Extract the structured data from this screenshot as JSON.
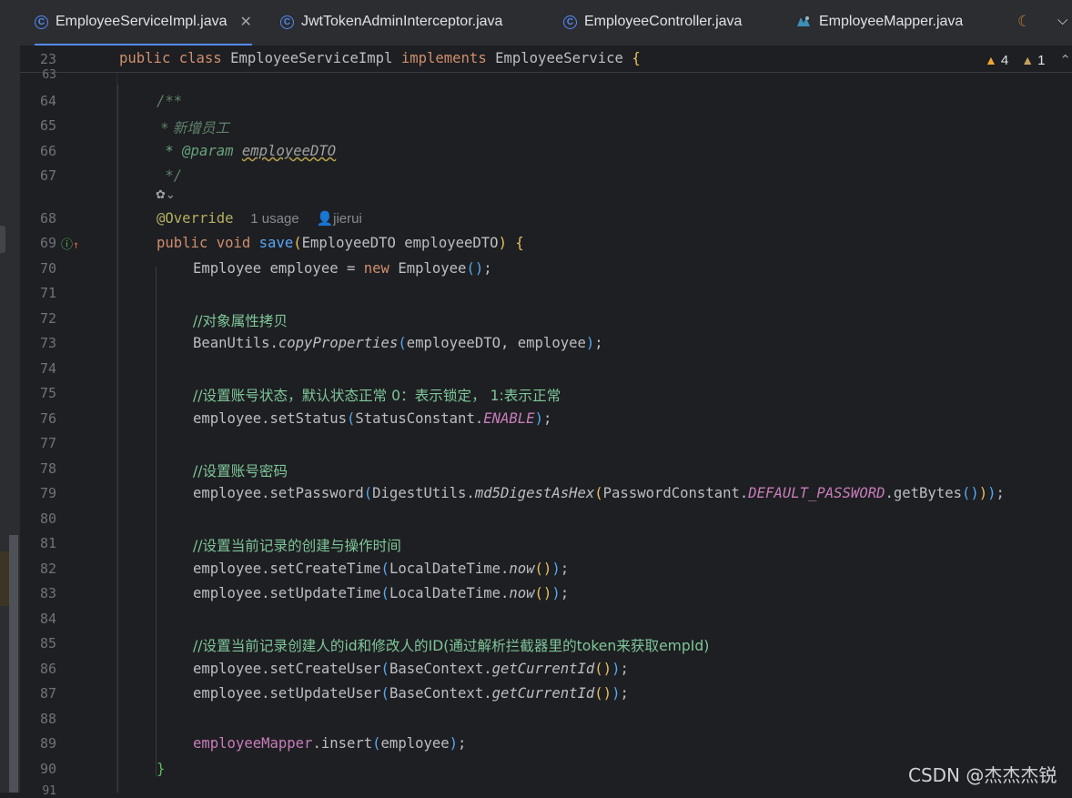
{
  "tabs": [
    {
      "label": "EmployeeServiceImpl.java",
      "active": true,
      "icon": "class-icon",
      "closable": true
    },
    {
      "label": "JwtTokenAdminInterceptor.java",
      "active": false,
      "icon": "class-icon"
    },
    {
      "label": "EmployeeController.java",
      "active": false,
      "icon": "class-icon"
    },
    {
      "label": "EmployeeMapper.java",
      "active": false,
      "icon": "mapper-icon"
    }
  ],
  "inspections": {
    "warnings": "4",
    "weak_warnings": "1"
  },
  "sticky": {
    "line": "23",
    "code": "public class EmployeeServiceImpl implements EmployeeService {"
  },
  "lines": {
    "l63": "63",
    "l64": "64",
    "l65": "65",
    "l66": "66",
    "l67": "67",
    "l68": "68",
    "l69": "69",
    "l70": "70",
    "l71": "71",
    "l72": "72",
    "l73": "73",
    "l74": "74",
    "l75": "75",
    "l76": "76",
    "l77": "77",
    "l78": "78",
    "l79": "79",
    "l80": "80",
    "l81": "81",
    "l82": "82",
    "l83": "83",
    "l84": "84",
    "l85": "85",
    "l86": "86",
    "l87": "87",
    "l88": "88",
    "l89": "89",
    "l90": "90",
    "l91": "91"
  },
  "hints": {
    "usages": "1 usage",
    "author": "jierui"
  },
  "code": {
    "doc_open": "/**",
    "doc_desc": " * 新增员工",
    "doc_param_tag": " * @param",
    "doc_param_name": "employeeDTO",
    "doc_close": " */",
    "override": "@Override",
    "c72": "//对象属性拷贝",
    "c75": "//设置账号状态，默认状态正常 0：表示锁定， 1:表示正常",
    "c78": "//设置账号密码",
    "c81": "//设置当前记录的创建与操作时间",
    "c85": "//设置当前记录创建人的id和修改人的ID(通过解析拦截器里的token来获取empId)",
    "close_brace": "}"
  },
  "watermark": "CSDN @杰杰杰锐",
  "colors": {
    "background": "#1e1f22",
    "keyword": "#cf8e6d",
    "method": "#56a8f5",
    "field": "#c77dbb",
    "comment": "#7a7e85",
    "annotation": "#b3ae60",
    "accent": "#548af7"
  }
}
